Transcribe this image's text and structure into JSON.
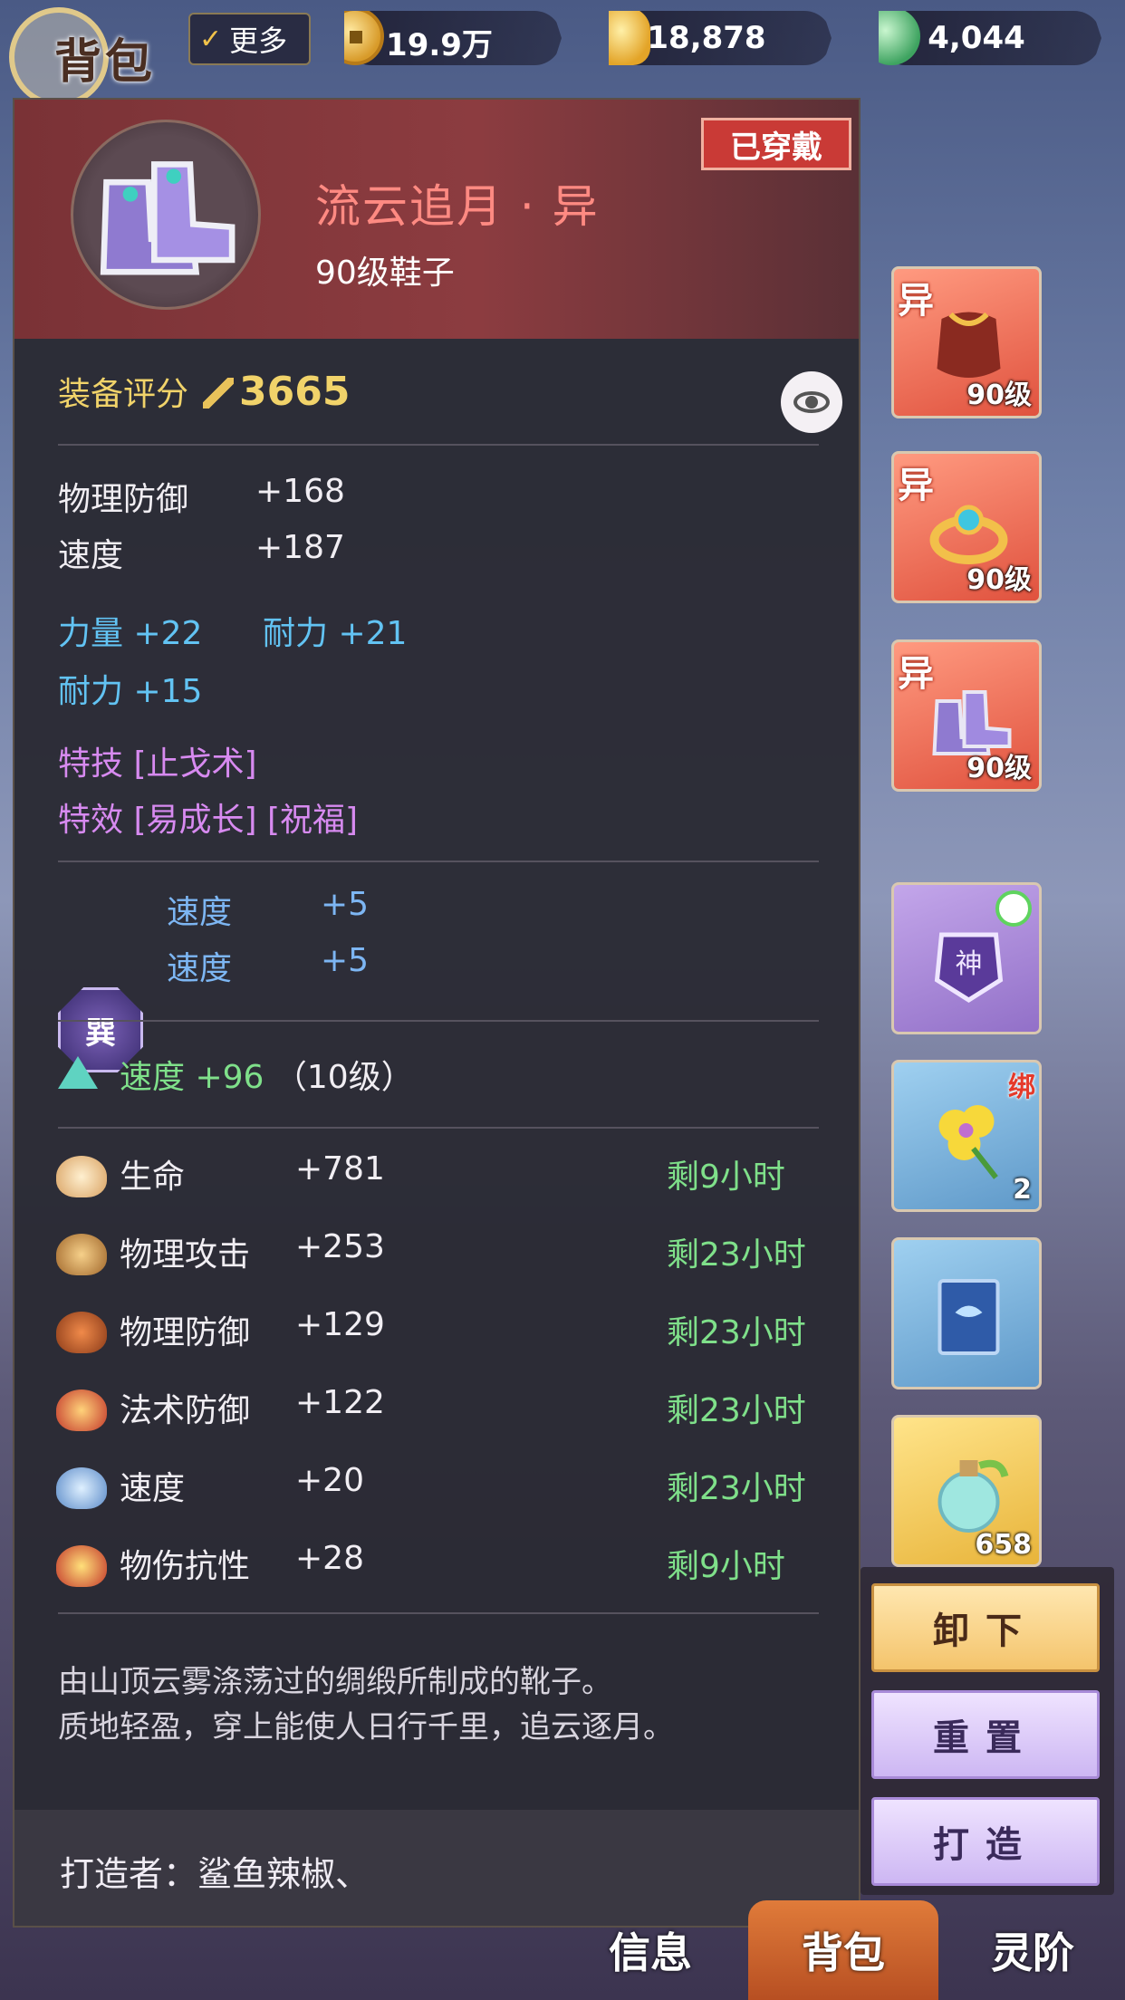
{
  "header": {
    "title": "背包",
    "more_label": "更多",
    "currencies": [
      {
        "icon": "copper-coin-icon",
        "value": "19.9万"
      },
      {
        "icon": "gold-ingot-icon",
        "value": "18,878"
      },
      {
        "icon": "jade-icon",
        "value": "4,044"
      }
    ]
  },
  "item": {
    "name": "流云追月 · 异",
    "subtitle": "90级鞋子",
    "status_badge": "已穿戴",
    "score_label": "装备评分",
    "score_value": "3665",
    "base_stats": [
      {
        "label": "物理防御",
        "value": "+168"
      },
      {
        "label": "速度",
        "value": "+187"
      }
    ],
    "attr_stats": [
      {
        "label": "力量",
        "value": "+22"
      },
      {
        "label": "耐力",
        "value": "+21"
      },
      {
        "label": "耐力",
        "value": "+15"
      }
    ],
    "skill_line": "特技 [止戈术]",
    "effect_line": "特效 [易成长] [祝福]",
    "rune": {
      "glyph": "巽",
      "stats": [
        {
          "label": "速度",
          "value": "+5"
        },
        {
          "label": "速度",
          "value": "+5"
        }
      ]
    },
    "gem_line": {
      "label": "速度",
      "value": "+96",
      "level": "（10级）"
    },
    "buffs": [
      {
        "icon": "steamed-bun-icon",
        "label": "生命",
        "value": "+781",
        "remaining": "剩9小时"
      },
      {
        "icon": "pot-dish-icon",
        "label": "物理攻击",
        "value": "+253",
        "remaining": "剩23小时"
      },
      {
        "icon": "roast-meat-icon",
        "label": "物理防御",
        "value": "+129",
        "remaining": "剩23小时"
      },
      {
        "icon": "noodle-bowl-icon",
        "label": "法术防御",
        "value": "+122",
        "remaining": "剩23小时"
      },
      {
        "icon": "skewer-icon",
        "label": "速度",
        "value": "+20",
        "remaining": "剩23小时"
      },
      {
        "icon": "egg-bowl-icon",
        "label": "物伤抗性",
        "value": "+28",
        "remaining": "剩9小时"
      }
    ],
    "description_1": "由山顶云雾涤荡过的绸缎所制成的靴子。",
    "description_2": "质地轻盈，穿上能使人日行千里，追云逐月。",
    "maker": "打造者：鲨鱼辣椒、"
  },
  "equip_slots": [
    {
      "tag": "异",
      "level": "90级",
      "icon": "cape-icon"
    },
    {
      "tag": "异",
      "level": "90级",
      "icon": "ring-icon"
    },
    {
      "tag": "异",
      "level": "90级",
      "icon": "boots-icon"
    }
  ],
  "inventory_slots": [
    {
      "icon": "charm-talisman-icon",
      "badge": "",
      "count": ""
    },
    {
      "icon": "yellow-flower-icon",
      "badge": "绑",
      "count": "2"
    },
    {
      "icon": "blue-book-icon",
      "badge": "",
      "count": ""
    },
    {
      "icon": "potion-bottle-icon",
      "badge": "",
      "count": "658"
    }
  ],
  "actions": {
    "unequip": "卸下",
    "reset": "重置",
    "forge": "打造"
  },
  "tabs": [
    {
      "label": "信息"
    },
    {
      "label": "背包",
      "active": true
    },
    {
      "label": "灵阶"
    }
  ],
  "colors": {
    "item_name": "#ff8a82",
    "score": "#f1d36a",
    "attr_blue": "#62c3f3",
    "special_purple": "#d78af0",
    "remaining_green": "#7fe08a",
    "badge_red": "#c93a36"
  }
}
